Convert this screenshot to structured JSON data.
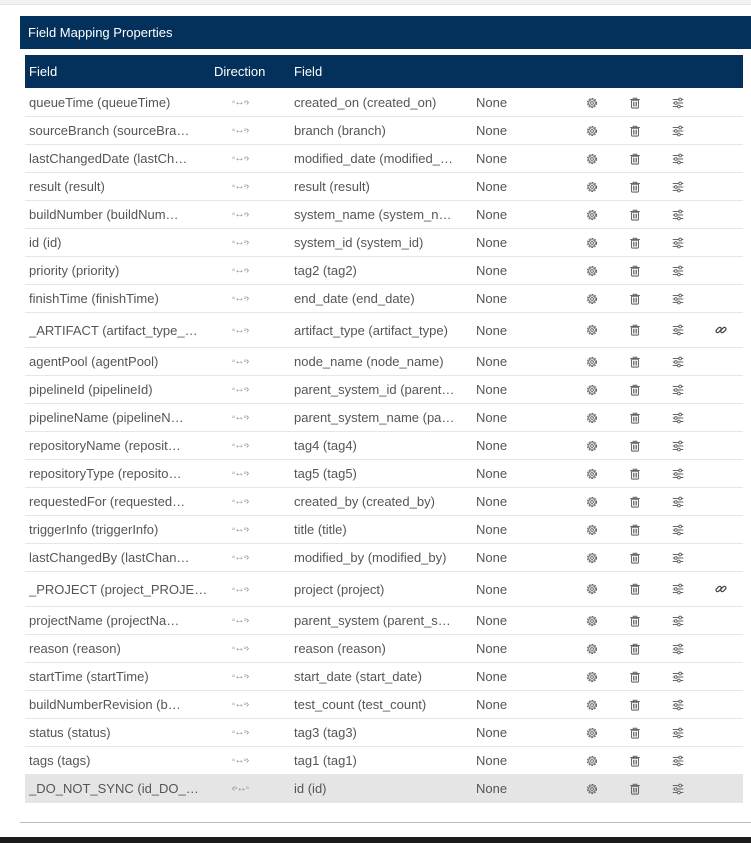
{
  "panel": {
    "title": "Field Mapping Properties"
  },
  "columns": {
    "source_field": "Field",
    "direction": "Direction",
    "target_field": "Field"
  },
  "colors": {
    "header_bg": "#04315c",
    "header_text": "#ffffff",
    "row_highlight": "#e5e5e5"
  },
  "direction_glyphs": {
    "bidirectional": "◦↔◦›",
    "left": "‹◦↔◦"
  },
  "rows": [
    {
      "source": "queueTime (queueTime)",
      "direction": "◦↔◦›",
      "target": "created_on (created_on)",
      "extra": "None"
    },
    {
      "source": "sourceBranch (sourceBra…",
      "direction": "◦↔◦›",
      "target": "branch (branch)",
      "extra": "None"
    },
    {
      "source": "lastChangedDate (lastCh…",
      "direction": "◦↔◦›",
      "target": "modified_date (modified_…",
      "extra": "None"
    },
    {
      "source": "result (result)",
      "direction": "◦↔◦›",
      "target": "result (result)",
      "extra": "None"
    },
    {
      "source": "buildNumber (buildNum…",
      "direction": "◦↔◦›",
      "target": "system_name (system_n…",
      "extra": "None"
    },
    {
      "source": "id (id)",
      "direction": "◦↔◦›",
      "target": "system_id (system_id)",
      "extra": "None"
    },
    {
      "source": "priority (priority)",
      "direction": "◦↔◦›",
      "target": "tag2 (tag2)",
      "extra": "None"
    },
    {
      "source": "finishTime (finishTime)",
      "direction": "◦↔◦›",
      "target": "end_date (end_date)",
      "extra": "None"
    },
    {
      "source": "_ARTIFACT (artifact_type_…",
      "direction": "◦↔◦›",
      "target": "artifact_type (artifact_type)",
      "extra": "None",
      "link": true
    },
    {
      "source": "agentPool (agentPool)",
      "direction": "◦↔◦›",
      "target": "node_name (node_name)",
      "extra": "None"
    },
    {
      "source": "pipelineId (pipelineId)",
      "direction": "◦↔◦›",
      "target": "parent_system_id (parent…",
      "extra": "None"
    },
    {
      "source": "pipelineName (pipelineN…",
      "direction": "◦↔◦›",
      "target": "parent_system_name (pa…",
      "extra": "None"
    },
    {
      "source": "repositoryName (reposit…",
      "direction": "◦↔◦›",
      "target": "tag4 (tag4)",
      "extra": "None"
    },
    {
      "source": "repositoryType (reposito…",
      "direction": "◦↔◦›",
      "target": "tag5 (tag5)",
      "extra": "None"
    },
    {
      "source": "requestedFor (requested…",
      "direction": "◦↔◦›",
      "target": "created_by (created_by)",
      "extra": "None"
    },
    {
      "source": "triggerInfo (triggerInfo)",
      "direction": "◦↔◦›",
      "target": "title (title)",
      "extra": "None"
    },
    {
      "source": "lastChangedBy (lastChan…",
      "direction": "◦↔◦›",
      "target": "modified_by (modified_by)",
      "extra": "None"
    },
    {
      "source": "_PROJECT (project_PROJE…",
      "direction": "◦↔◦›",
      "target": "project (project)",
      "extra": "None",
      "link": true
    },
    {
      "source": "projectName (projectNa…",
      "direction": "◦↔◦›",
      "target": "parent_system (parent_s…",
      "extra": "None"
    },
    {
      "source": "reason (reason)",
      "direction": "◦↔◦›",
      "target": "reason (reason)",
      "extra": "None"
    },
    {
      "source": "startTime (startTime)",
      "direction": "◦↔◦›",
      "target": "start_date (start_date)",
      "extra": "None"
    },
    {
      "source": "buildNumberRevision (b…",
      "direction": "◦↔◦›",
      "target": "test_count (test_count)",
      "extra": "None"
    },
    {
      "source": "status (status)",
      "direction": "◦↔◦›",
      "target": "tag3 (tag3)",
      "extra": "None"
    },
    {
      "source": "tags (tags)",
      "direction": "◦↔◦›",
      "target": "tag1 (tag1)",
      "extra": "None"
    },
    {
      "source": "_DO_NOT_SYNC (id_DO_…",
      "direction": "‹◦↔◦",
      "target": "id (id)",
      "extra": "None",
      "highlight": true
    }
  ]
}
